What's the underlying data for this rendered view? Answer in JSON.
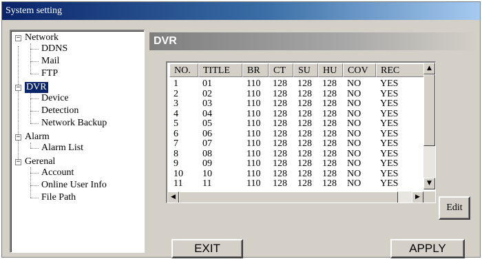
{
  "window": {
    "title": "System setting"
  },
  "tree": {
    "network": {
      "label": "Network",
      "children": [
        "DDNS",
        "Mail",
        "FTP"
      ]
    },
    "dvr": {
      "label": "DVR",
      "children": [
        "Device",
        "Detection",
        "Network Backup"
      ]
    },
    "alarm": {
      "label": "Alarm",
      "children": [
        "Alarm List"
      ]
    },
    "general": {
      "label": "Gerenal",
      "children": [
        "Account",
        "Online User Info",
        "File Path"
      ]
    }
  },
  "panel": {
    "title": "DVR"
  },
  "table": {
    "columns": [
      "NO.",
      "TITLE",
      "BR",
      "CT",
      "SU",
      "HU",
      "COV",
      "REC"
    ],
    "rows": [
      [
        "1",
        "01",
        "110",
        "128",
        "128",
        "128",
        "NO",
        "YES"
      ],
      [
        "2",
        "02",
        "110",
        "128",
        "128",
        "128",
        "NO",
        "YES"
      ],
      [
        "3",
        "03",
        "110",
        "128",
        "128",
        "128",
        "NO",
        "YES"
      ],
      [
        "4",
        "04",
        "110",
        "128",
        "128",
        "128",
        "NO",
        "YES"
      ],
      [
        "5",
        "05",
        "110",
        "128",
        "128",
        "128",
        "NO",
        "YES"
      ],
      [
        "6",
        "06",
        "110",
        "128",
        "128",
        "128",
        "NO",
        "YES"
      ],
      [
        "7",
        "07",
        "110",
        "128",
        "128",
        "128",
        "NO",
        "YES"
      ],
      [
        "8",
        "08",
        "110",
        "128",
        "128",
        "128",
        "NO",
        "YES"
      ],
      [
        "9",
        "09",
        "110",
        "128",
        "128",
        "128",
        "NO",
        "YES"
      ],
      [
        "10",
        "10",
        "110",
        "128",
        "128",
        "128",
        "NO",
        "YES"
      ],
      [
        "11",
        "11",
        "110",
        "128",
        "128",
        "128",
        "NO",
        "YES"
      ]
    ]
  },
  "buttons": {
    "edit": "Edit",
    "exit": "EXIT",
    "apply": "APPLY"
  },
  "icons": {
    "collapse": "minus-box-icon",
    "scroll_up": "arrow-up-icon",
    "scroll_down": "arrow-down-icon",
    "scroll_left": "arrow-left-icon",
    "scroll_right": "arrow-right-icon"
  },
  "colors": {
    "titlebar": "#0a246a",
    "selection": "#0a246a",
    "panel_header": "#7e7e7e",
    "face": "#d4d0c8"
  }
}
